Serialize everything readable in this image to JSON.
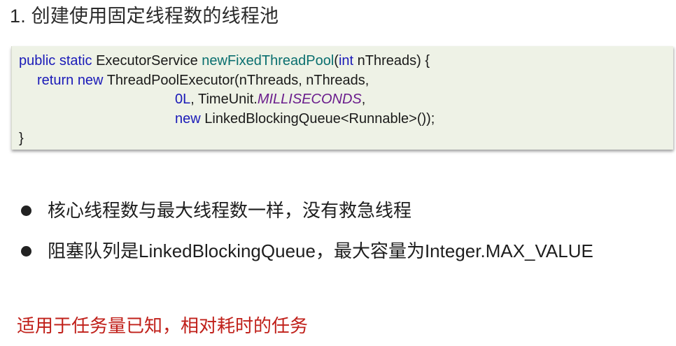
{
  "heading": "1. 创建使用固定线程数的线程池",
  "code": {
    "line1": {
      "kw1": "public",
      "kw2": "static",
      "type": "ExecutorService",
      "method": "newFixedThreadPool",
      "open": "(",
      "kw3": "int",
      "rest": " nThreads) {"
    },
    "line2": {
      "kw": "return",
      "kw2": "new",
      "rest": " ThreadPoolExecutor(nThreads, nThreads,"
    },
    "line3": {
      "num": "0L",
      "mid": ", TimeUnit.",
      "const": "MILLISECONDS",
      "end": ","
    },
    "line4": {
      "kw": "new",
      "rest": " LinkedBlockingQueue<Runnable>());"
    },
    "line5": "}"
  },
  "bullets": [
    "核心线程数与最大线程数一样，没有救急线程",
    "阻塞队列是LinkedBlockingQueue，最大容量为Integer.MAX_VALUE"
  ],
  "summary": "适用于任务量已知，相对耗时的任务",
  "colors": {
    "keyword": "#1a1ab8",
    "method": "#0a6f6f",
    "constant": "#6a1d8c",
    "summary": "#c0201a",
    "code_background": "#eef2e6"
  }
}
